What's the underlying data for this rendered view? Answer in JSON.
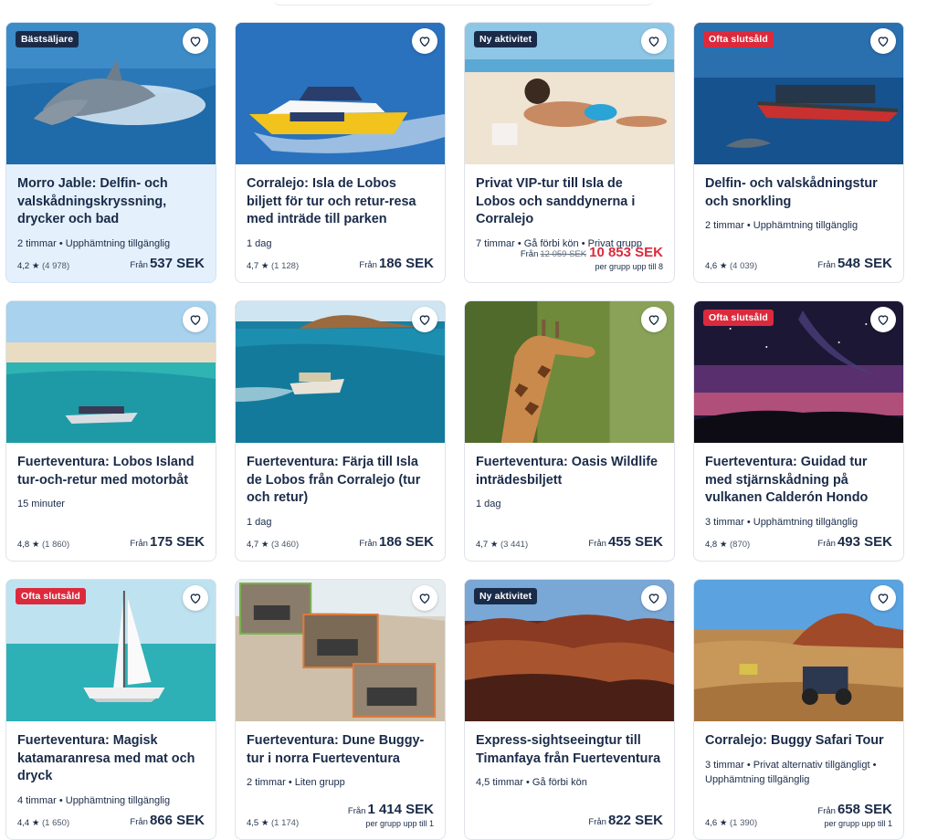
{
  "cards": [
    {
      "badge": "Bästsäljare",
      "title": "Morro Jable: Delfin- och valskådningskryssning, drycker och bad",
      "meta": "2 timmar • Upphämtning tillgänglig",
      "rating": "4,2 ★",
      "count": "(4 978)",
      "from": "Från",
      "price": "537 SEK",
      "icon": "heart-icon"
    },
    {
      "title": "Corralejo: Isla de Lobos biljett för tur och retur-resa med inträde till parken",
      "meta": "1 dag",
      "rating": "4,7 ★",
      "count": "(1 128)",
      "from": "Från",
      "price": "186 SEK",
      "icon": "heart-icon"
    },
    {
      "badge": "Ny aktivitet",
      "title": "Privat VIP-tur till Isla de Lobos och sanddynerna i Corralejo",
      "meta": "7 timmar • Gå förbi kön • Privat grupp",
      "from": "Från",
      "old_price": "12 059 SEK",
      "price": "10 853 SEK",
      "price_note": "per grupp upp till 8",
      "icon": "heart-icon"
    },
    {
      "badge": "Ofta slutsåld",
      "title": "Delfin- och valskådningstur och snorkling",
      "meta": "2 timmar • Upphämtning tillgänglig",
      "rating": "4,6 ★",
      "count": "(4 039)",
      "from": "Från",
      "price": "548 SEK",
      "icon": "heart-icon"
    },
    {
      "title": "Fuerteventura: Lobos Island tur-och-retur med motorbåt",
      "meta": "15 minuter",
      "rating": "4,8 ★",
      "count": "(1 860)",
      "from": "Från",
      "price": "175 SEK",
      "icon": "heart-icon"
    },
    {
      "title": "Fuerteventura: Färja till Isla de Lobos från Corralejo (tur och retur)",
      "meta": "1 dag",
      "rating": "4,7 ★",
      "count": "(3 460)",
      "from": "Från",
      "price": "186 SEK",
      "icon": "heart-icon"
    },
    {
      "title": "Fuerteventura: Oasis Wildlife inträdesbiljett",
      "meta": "1 dag",
      "rating": "4,7 ★",
      "count": "(3 441)",
      "from": "Från",
      "price": "455 SEK",
      "icon": "heart-icon"
    },
    {
      "badge": "Ofta slutsåld",
      "title": "Fuerteventura: Guidad tur med stjärnskådning på vulkanen Calderón Hondo",
      "meta": "3 timmar • Upphämtning tillgänglig",
      "rating": "4,8 ★",
      "count": "(870)",
      "from": "Från",
      "price": "493 SEK",
      "icon": "heart-icon"
    },
    {
      "badge": "Ofta slutsåld",
      "title": "Fuerteventura: Magisk katamaranresa med mat och dryck",
      "meta": "4 timmar • Upphämtning tillgänglig",
      "rating": "4,4 ★",
      "count": "(1 650)",
      "from": "Från",
      "price": "866 SEK",
      "icon": "heart-icon"
    },
    {
      "title": "Fuerteventura: Dune Buggy-tur i norra Fuerteventura",
      "meta": "2 timmar • Liten grupp",
      "rating": "4,5 ★",
      "count": "(1 174)",
      "from": "Från",
      "price": "1 414 SEK",
      "price_note": "per grupp upp till 1",
      "icon": "heart-icon"
    },
    {
      "badge": "Ny aktivitet",
      "title": "Express-sightseeingtur till Timanfaya från Fuerteventura",
      "meta": "4,5 timmar • Gå förbi kön",
      "from": "Från",
      "price": "822 SEK",
      "icon": "heart-icon"
    },
    {
      "title": "Corralejo: Buggy Safari Tour",
      "meta": "3 timmar • Privat alternativ tillgängligt • Upphämtning tillgänglig",
      "rating": "4,6 ★",
      "count": "(1 390)",
      "from": "Från",
      "price": "658 SEK",
      "price_note": "per grupp upp till 1",
      "icon": "heart-icon"
    }
  ],
  "colors": {
    "navy": "#1a2b49",
    "red": "#dc2a3c",
    "highlight": "#e4f0fb"
  }
}
